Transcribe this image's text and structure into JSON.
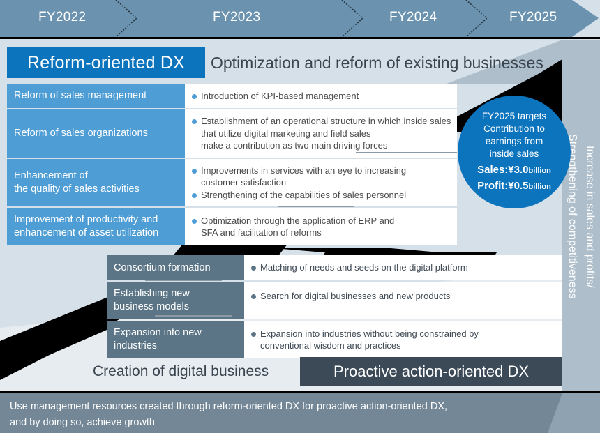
{
  "timeline": {
    "years": [
      "FY2022",
      "FY2023",
      "FY2024",
      "FY2025"
    ]
  },
  "reform": {
    "badge_label": "Reform-oriented DX",
    "caption": "Optimization and reform of existing businesses",
    "rows": [
      {
        "head": "Reform of sales management",
        "bullets": [
          "Introduction of KPI-based management"
        ]
      },
      {
        "head": "Reform of sales organizations",
        "bullets": [
          "Establishment of an operational structure in which inside sales\nthat utilize digital marketing and field sales\nmake a contribution as two main driving forces"
        ]
      },
      {
        "head": "Enhancement of\nthe quality of sales activities",
        "bullets": [
          "Improvements in services with an eye to increasing\ncustomer satisfaction",
          "Strengthening of the capabilities of sales personnel"
        ]
      },
      {
        "head": "Improvement of productivity and\nenhancement of asset utilization",
        "bullets": [
          "Optimization through the application of ERP and\nSFA and facilitation of reforms"
        ]
      }
    ]
  },
  "target_circle": {
    "heading": "FY2025 targets\nContribution to\nearnings from\ninside sales",
    "sales_label": "Sales:¥3.0",
    "sales_unit": "billion",
    "profit_label": "Profit:¥0.5",
    "profit_unit": "billion"
  },
  "side_banner": {
    "text": "Increase in sales and profits/\nStrengthening of competitiveness"
  },
  "proactive": {
    "badge_label": "Proactive action-oriented DX",
    "caption": "Creation of digital business",
    "rows": [
      {
        "head": "Consortium formation",
        "bullets": [
          "Matching of needs and seeds on the digital platform"
        ]
      },
      {
        "head": "Establishing new\nbusiness models",
        "bullets": [
          "Search for digital businesses and new products"
        ]
      },
      {
        "head": "Expansion into new\nindustries",
        "bullets": [
          "Expansion into industries without being constrained by\nconventional wisdom and practices"
        ]
      }
    ]
  },
  "footer": {
    "text": "Use management resources created through reform-oriented DX for proactive action-oriented DX,\nand by doing so, achieve growth"
  },
  "colors": {
    "page_background": "#d5e0e9",
    "timeline_fill": "#6b93b0",
    "accent_blue": "#0c73bd",
    "table_blue": "#4e9dd4",
    "table_dark": "#5b7587",
    "proactive_badge": "#3c4a58",
    "footer_bar": "#738797",
    "side_bar": "#aebecb",
    "text_dark": "#3b4550"
  }
}
